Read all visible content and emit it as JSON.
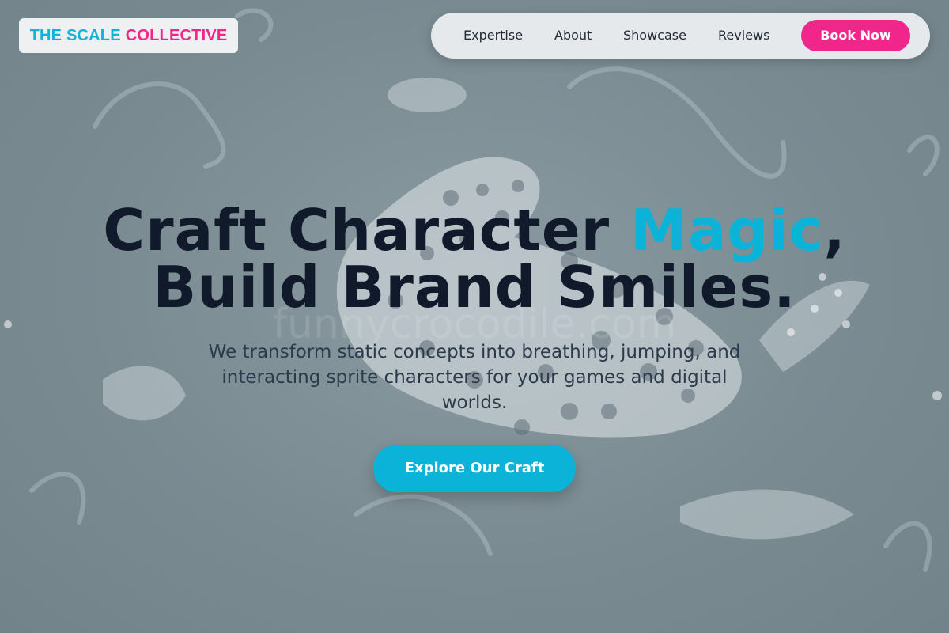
{
  "brand": {
    "name_part1": "THE SCALE",
    "name_part2": "COLLECTIVE",
    "color_primary": "#12b3d6",
    "color_secondary": "#f0268a"
  },
  "nav": {
    "items": [
      {
        "label": "Expertise"
      },
      {
        "label": "About"
      },
      {
        "label": "Showcase"
      },
      {
        "label": "Reviews"
      }
    ],
    "book_label": "Book Now"
  },
  "hero": {
    "title_line1_start": "Craft Character ",
    "title_line1_accent": "Magic",
    "title_line1_end": ",",
    "title_line2": "Build Brand Smiles.",
    "subtitle": "We transform static concepts into breathing, jumping, and interacting sprite characters for your games and digital worlds.",
    "cta_label": "Explore Our Craft",
    "watermark": "funnycrocodile.com"
  },
  "background": {
    "description_icons": [
      "seahorse-doodle-icon",
      "polka-dot-creature-icon",
      "fish-doodle-icon"
    ]
  }
}
